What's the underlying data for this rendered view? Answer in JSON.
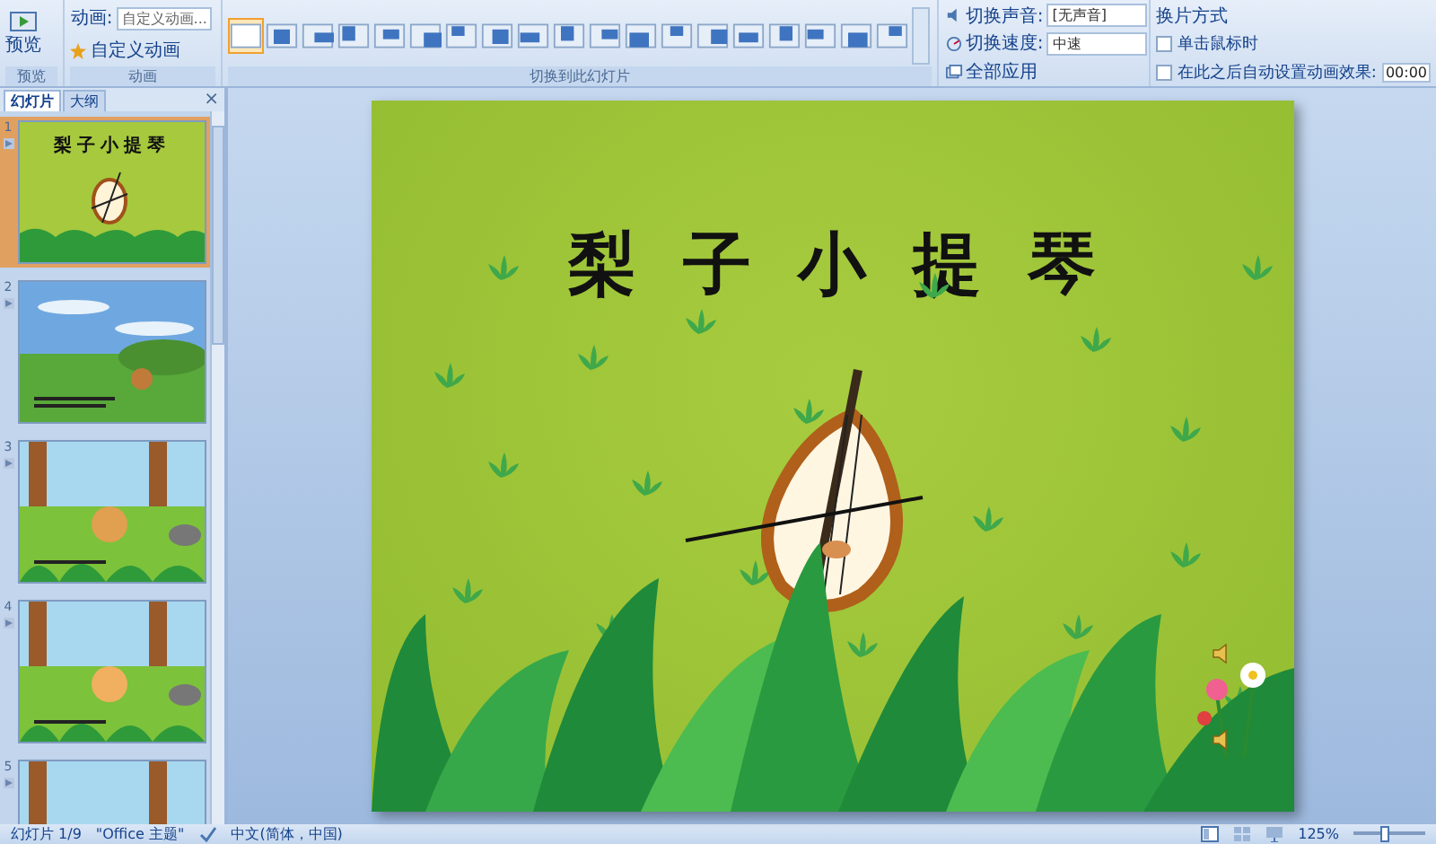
{
  "ribbon": {
    "preview_group": {
      "button": "预览",
      "label": "预览"
    },
    "animation_group": {
      "animate_label": "动画:",
      "animate_value": "自定义动画...",
      "custom_button": "自定义动画",
      "label": "动画"
    },
    "transition_gallery": {
      "label": "切换到此幻灯片",
      "items": [
        {
          "selected": true
        },
        {
          "selected": false
        },
        {
          "selected": false
        },
        {
          "selected": false
        },
        {
          "selected": false
        },
        {
          "selected": false
        },
        {
          "selected": false
        },
        {
          "selected": false
        },
        {
          "selected": false
        },
        {
          "selected": false
        },
        {
          "selected": false
        },
        {
          "selected": false
        },
        {
          "selected": false
        },
        {
          "selected": false
        },
        {
          "selected": false
        },
        {
          "selected": false
        },
        {
          "selected": false
        },
        {
          "selected": false
        },
        {
          "selected": false
        }
      ]
    },
    "transition_settings": {
      "sound_label": "切换声音:",
      "sound_value": "[无声音]",
      "speed_label": "切换速度:",
      "speed_value": "中速",
      "apply_all": "全部应用"
    },
    "advance": {
      "title": "换片方式",
      "options": [
        {
          "label": "单击鼠标时",
          "checked": false
        },
        {
          "label": "在此之后自动设置动画效果:",
          "checked": false,
          "time": "00:00"
        }
      ]
    }
  },
  "panel": {
    "tabs": [
      {
        "label": "幻灯片",
        "selected": true
      },
      {
        "label": "大纲",
        "selected": false
      }
    ],
    "close": "×",
    "thumbnails": [
      {
        "number": "1",
        "selected": true,
        "kind": "title",
        "title": "梨子小提琴"
      },
      {
        "number": "2",
        "selected": false,
        "kind": "meadow"
      },
      {
        "number": "3",
        "selected": false,
        "kind": "forest"
      },
      {
        "number": "4",
        "selected": false,
        "kind": "forest"
      },
      {
        "number": "5",
        "selected": false,
        "kind": "forest"
      }
    ]
  },
  "slide": {
    "title": "梨子小提琴"
  },
  "status_bar": {
    "slide_count": "幻灯片 1/9",
    "theme": "\"Office 主题\"",
    "language": "中文(简体，中国)",
    "zoom": "125%",
    "zoom_slider": {
      "level": 0.45
    }
  }
}
